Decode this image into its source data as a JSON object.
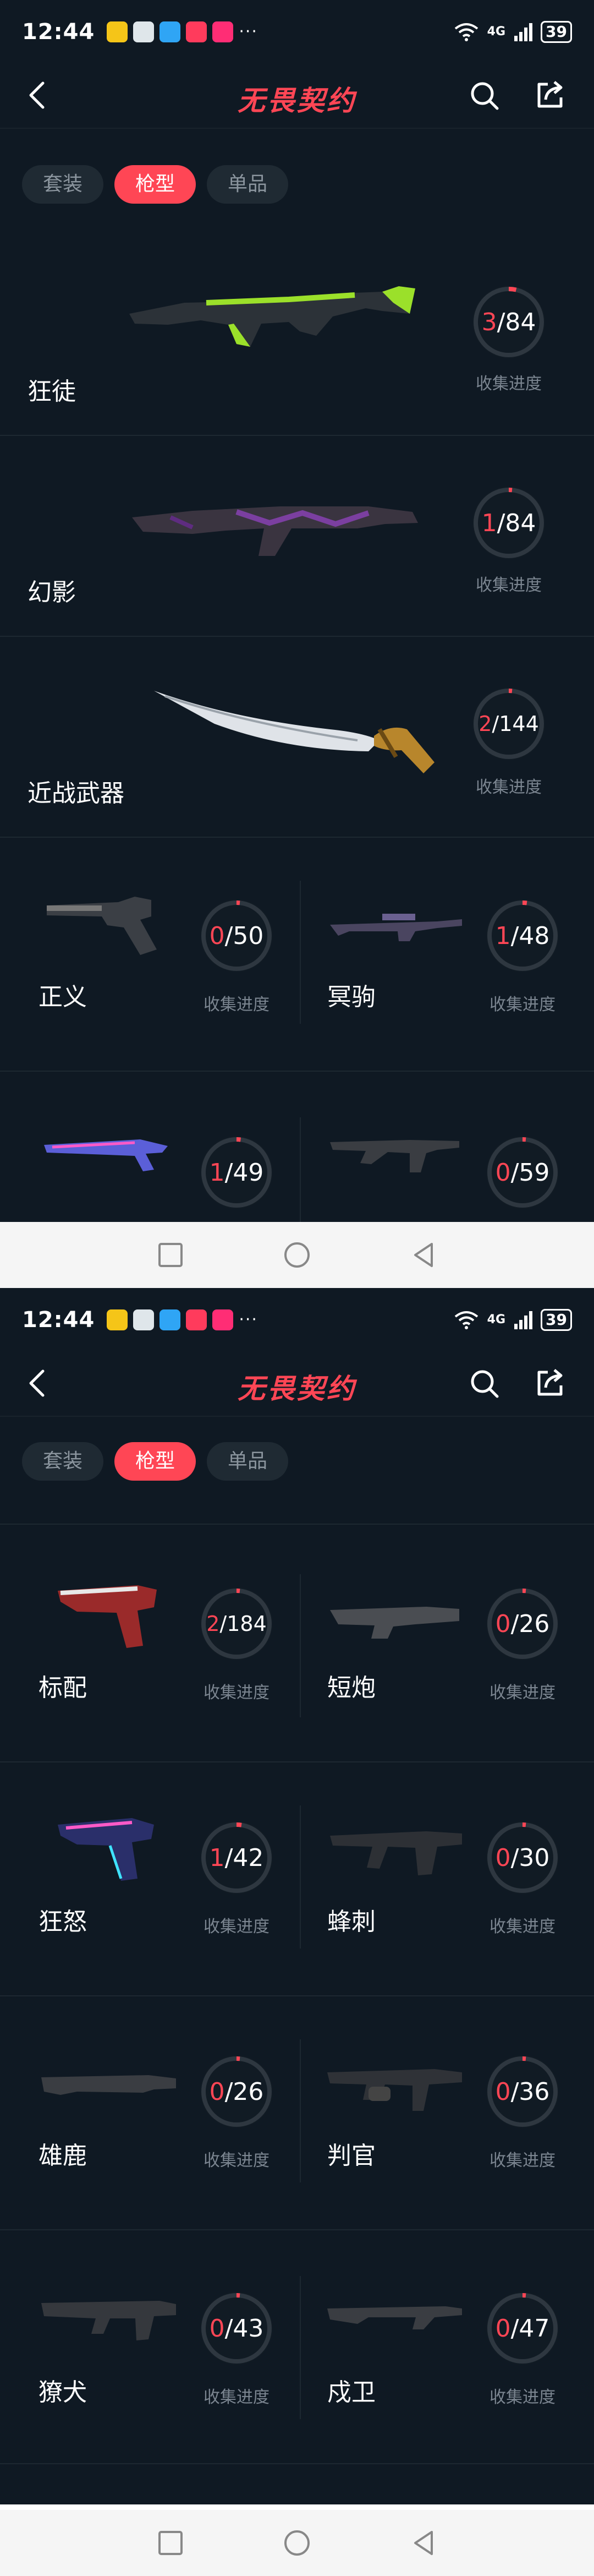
{
  "status": {
    "time": "12:44",
    "dots": "···",
    "network": "4G",
    "battery": "39"
  },
  "header": {
    "title": "无畏契约"
  },
  "tabs": [
    {
      "label": "套装"
    },
    {
      "label": "枪型"
    },
    {
      "label": "单品"
    }
  ],
  "progress_label": "收集进度",
  "screen1": {
    "weapons": [
      {
        "name": "狂徒",
        "owned": "3",
        "total": "/84",
        "progress": 0.036
      },
      {
        "name": "幻影",
        "owned": "1",
        "total": "/84",
        "progress": 0.012
      },
      {
        "name": "近战武器",
        "owned": "2",
        "total": "/144",
        "progress": 0.014
      },
      {
        "name": "正义",
        "owned": "0",
        "total": "/50",
        "progress": 0
      },
      {
        "name": "冥驹",
        "owned": "1",
        "total": "/48",
        "progress": 0.021
      },
      {
        "name": "",
        "owned": "1",
        "total": "/49",
        "progress": 0.02
      },
      {
        "name": "",
        "owned": "0",
        "total": "/59",
        "progress": 0
      }
    ]
  },
  "screen2": {
    "weapons": [
      {
        "name": "标配",
        "owned": "2",
        "total": "/184",
        "progress": 0.011
      },
      {
        "name": "短炮",
        "owned": "0",
        "total": "/26",
        "progress": 0
      },
      {
        "name": "狂怒",
        "owned": "1",
        "total": "/42",
        "progress": 0.024
      },
      {
        "name": "蜂刺",
        "owned": "0",
        "total": "/30",
        "progress": 0
      },
      {
        "name": "雄鹿",
        "owned": "0",
        "total": "/26",
        "progress": 0
      },
      {
        "name": "判官",
        "owned": "0",
        "total": "/36",
        "progress": 0
      },
      {
        "name": "獠犬",
        "owned": "0",
        "total": "/43",
        "progress": 0
      },
      {
        "name": "戍卫",
        "owned": "0",
        "total": "/47",
        "progress": 0
      }
    ]
  },
  "colors": {
    "accent": "#ff4655",
    "bg": "#0f1923"
  },
  "icons": [
    "back-arrow-icon",
    "search-icon",
    "share-icon",
    "wifi-icon",
    "signal-icon",
    "battery-icon",
    "square-nav-icon",
    "circle-nav-icon",
    "triangle-nav-icon"
  ]
}
